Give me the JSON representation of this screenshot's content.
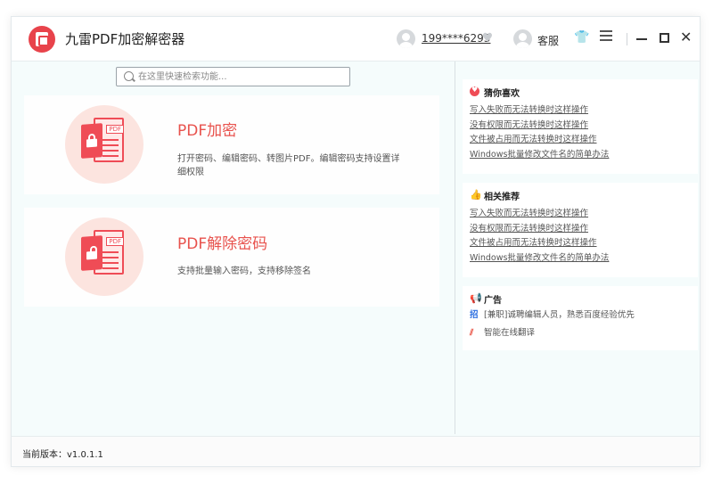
{
  "window": {
    "title": "九雷PDF加密解密器"
  },
  "header": {
    "user_name": "199****6295",
    "customer_service": "客服"
  },
  "search": {
    "placeholder": "在这里快速检索功能...",
    "value": ""
  },
  "cards": [
    {
      "title": "PDF加密",
      "description": "打开密码、编辑密码、转图片PDF。编辑密码支持设置详细权限",
      "doc_tag": "PDF"
    },
    {
      "title": "PDF解除密码",
      "description": "支持批量输入密码，支持移除签名",
      "doc_tag": "PDF"
    }
  ],
  "sidebar": {
    "guess": {
      "title": "猜你喜欢",
      "links": [
        "写入失败而无法转换时这样操作",
        "没有权限而无法转换时这样操作",
        "文件被占用而无法转换时这样操作",
        "Windows批量修改文件名的简单办法"
      ]
    },
    "related": {
      "title": "相关推荐",
      "links": [
        "写入失败而无法转换时这样操作",
        "没有权限而无法转换时这样操作",
        "文件被占用而无法转换时这样操作",
        "Windows批量修改文件名的简单办法"
      ]
    },
    "ads": {
      "title": "广告",
      "items": [
        {
          "icon_text": "招",
          "text": "[兼职]诚聘编辑人员，熟悉百度经验优先"
        },
        {
          "icon_text": "",
          "text": "智能在线翻译"
        }
      ]
    }
  },
  "footer": {
    "version": "当前版本：v1.0.1.1"
  },
  "colors": {
    "accent": "#e8524d",
    "brand_red": "#ef4c56",
    "background": "#f5fcfc"
  }
}
